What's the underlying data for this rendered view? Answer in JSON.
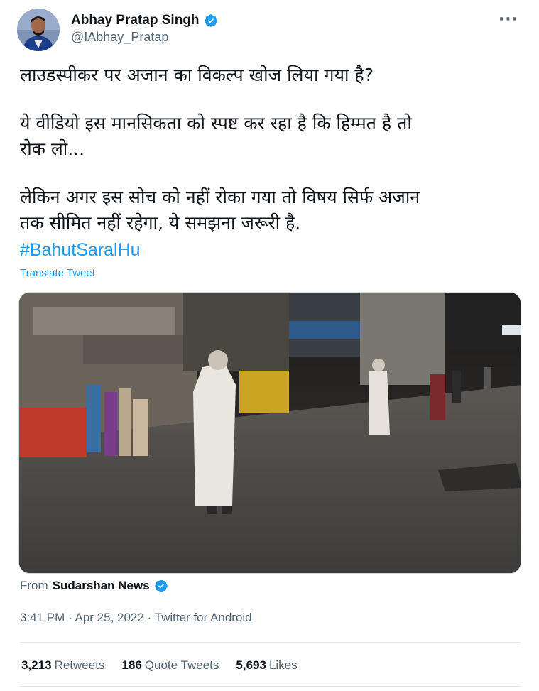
{
  "author": {
    "name": "Abhay Pratap Singh",
    "handle": "@IAbhay_Pratap"
  },
  "menu_icon": "more-dots-icon",
  "tweet": {
    "line1": "लाउडस्पीकर पर अजान का विकल्प खोज लिया गया है?",
    "line2": "ये वीडियो इस मानसिकता को स्पष्ट कर रहा है कि हिम्मत है तो",
    "line3": "रोक लो...",
    "line4": "लेकिन अगर इस सोच को नहीं रोका गया तो विषय सिर्फ अजान",
    "line5": "तक सीमित नहीं रहेगा, ये समझना जरूरी है.",
    "hashtag": "#BahutSaralHu",
    "translate": "Translate Tweet"
  },
  "source": {
    "prefix": "From",
    "name": "Sudarshan News"
  },
  "meta": {
    "time": "3:41 PM · Apr 25, 2022 · Twitter for Android"
  },
  "stats": {
    "retweets_count": "3,213",
    "retweets_label": "Retweets",
    "quotes_count": "186",
    "quotes_label": "Quote Tweets",
    "likes_count": "5,693",
    "likes_label": "Likes"
  },
  "colors": {
    "link": "#1d9bf0",
    "secondary": "#536471",
    "primary": "#0f1419"
  }
}
